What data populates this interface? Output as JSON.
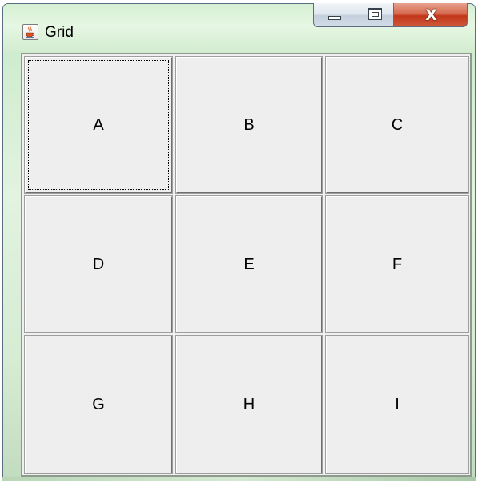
{
  "window": {
    "title": "Grid",
    "icon": "java-cup-icon"
  },
  "caption_buttons": {
    "minimize_icon": "minimize-icon",
    "maximize_icon": "maximize-icon",
    "close_label": "X"
  },
  "grid": {
    "focused": "A",
    "buttons": [
      [
        "A",
        "B",
        "C"
      ],
      [
        "D",
        "E",
        "F"
      ],
      [
        "G",
        "H",
        "I"
      ]
    ]
  },
  "colors": {
    "title_glass": "#d6f0d4",
    "close_button": "#c2361a",
    "button_face": "#eeeeee"
  }
}
